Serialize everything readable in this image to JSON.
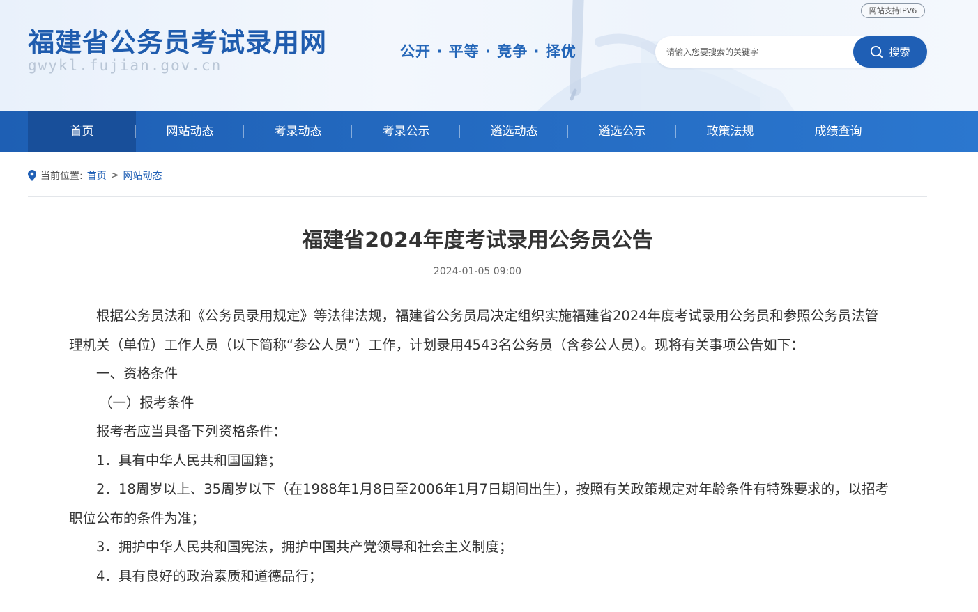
{
  "header": {
    "site_title": "福建省公务员考试录用网",
    "site_domain": "gwykl.fujian.gov.cn",
    "slogan": "公开 · 平等 · 竞争 · 择优",
    "ipv6_badge": "网站支持IPV6",
    "search": {
      "placeholder": "请输入您要搜索的关键字",
      "button_label": "搜索"
    }
  },
  "nav": {
    "items": [
      {
        "label": "首页",
        "active": true
      },
      {
        "label": "网站动态"
      },
      {
        "label": "考录动态"
      },
      {
        "label": "考录公示"
      },
      {
        "label": "遴选动态"
      },
      {
        "label": "遴选公示"
      },
      {
        "label": "政策法规"
      },
      {
        "label": "成绩查询"
      }
    ]
  },
  "breadcrumb": {
    "prefix": "当前位置:",
    "home": "首页",
    "separator": ">",
    "current": "网站动态"
  },
  "article": {
    "title": "福建省2024年度考试录用公务员公告",
    "date": "2024-01-05 09:00",
    "paragraphs": [
      "根据公务员法和《公务员录用规定》等法律法规，福建省公务员局决定组织实施福建省2024年度考试录用公务员和参照公务员法管理机关（单位）工作人员（以下简称“参公人员”）工作，计划录用4543名公务员（含参公人员）。现将有关事项公告如下：",
      "一、资格条件",
      "（一）报考条件",
      "报考者应当具备下列资格条件：",
      "1．具有中华人民共和国国籍；",
      "2．18周岁以上、35周岁以下（在1988年1月8日至2006年1月7日期间出生），按照有关政策规定对年龄条件有特殊要求的，以招考职位公布的条件为准；",
      "3．拥护中华人民共和国宪法，拥护中国共产党领导和社会主义制度；",
      "4．具有良好的政治素质和道德品行；"
    ]
  },
  "colors": {
    "brand_blue": "#1f5cae",
    "nav_blue": "#2466b8",
    "nav_active": "#184f9a",
    "link_blue": "#1f5fb5"
  }
}
